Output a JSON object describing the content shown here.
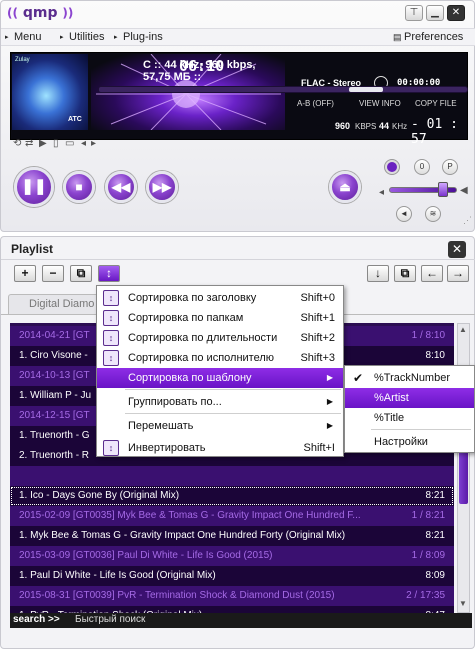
{
  "player": {
    "app_name": "qmp",
    "menu": {
      "menu_label": "Menu",
      "utilities_label": "Utilities",
      "plugins_label": "Plug-ins",
      "preferences_label": "Preferences"
    },
    "display": {
      "cover_artist": "Zulay",
      "time_big": "06:10",
      "track_info": "C :: 44 kHz, 960 kbps, 57,75 МБ ::",
      "format": "FLAC - Stereo",
      "timer": "00:00:00",
      "ab_label": "A-B (OFF)",
      "view_info": "VIEW INFO",
      "copy_file": "COPY FILE",
      "bitrate": "960",
      "bitrate_unit": "KBPS",
      "samplerate": "44",
      "samplerate_unit": "KHz",
      "remaining": "- 01 : 57",
      "seek_progress": 0.75
    },
    "controls": {
      "play_icon": "pause-icon",
      "volume": 0.85
    }
  },
  "playlist": {
    "title": "Playlist",
    "tab_label": "Digital Diamo",
    "rows": [
      {
        "type": "group",
        "left": "2014-04-21 [GT",
        "right": "1 / 8:10"
      },
      {
        "type": "track",
        "left": "1. Ciro Visone - ",
        "right": "8:10"
      },
      {
        "type": "group",
        "left": "2014-10-13 [GT",
        "right": ""
      },
      {
        "type": "track",
        "left": "1. William P - Ju",
        "right": ""
      },
      {
        "type": "group",
        "left": "2014-12-15 [GT",
        "right": ""
      },
      {
        "type": "track",
        "left": "1. Truenorth - G",
        "right": ""
      },
      {
        "type": "track",
        "left": "2. Truenorth - R",
        "right": ""
      },
      {
        "type": "group",
        "left": "",
        "right": ""
      },
      {
        "type": "track",
        "left": "1. Ico - Days Gone By (Original Mix)",
        "right": "8:21",
        "selected": true
      },
      {
        "type": "group",
        "left": "2015-02-09 [GT0035] Myk Bee & Tomas G - Gravity Impact One Hundred F...",
        "right": "1 / 8:21"
      },
      {
        "type": "track",
        "left": "1. Myk Bee & Tomas G - Gravity Impact One Hundred Forty (Original Mix)",
        "right": "8:21"
      },
      {
        "type": "group",
        "left": "2015-03-09 [GT0036] Paul Di White - Life Is Good (2015)",
        "right": "1 / 8:09"
      },
      {
        "type": "track",
        "left": "1. Paul Di White - Life Is Good (Original Mix)",
        "right": "8:09"
      },
      {
        "type": "group",
        "left": "2015-08-31 [GT0039] PvR - Termination Shock & Diamond Dust (2015)",
        "right": "2 / 17:35"
      },
      {
        "type": "track",
        "left": "1. PvR - Termination Shock (Original Mix)",
        "right": "8:47"
      }
    ],
    "search_label": "search >>",
    "search_placeholder": "Быстрый поиск"
  },
  "context_menu": {
    "items": [
      {
        "label": "Сортировка по заголовку",
        "shortcut": "Shift+0",
        "icon": "sort-title-icon"
      },
      {
        "label": "Сортировка по папкам",
        "shortcut": "Shift+1",
        "icon": "sort-folder-icon"
      },
      {
        "label": "Сортировка по длительности",
        "shortcut": "Shift+2",
        "icon": "sort-duration-icon"
      },
      {
        "label": "Сортировка по исполнителю",
        "shortcut": "Shift+3",
        "icon": "sort-artist-icon"
      },
      {
        "label": "Сортировка по шаблону",
        "shortcut": "",
        "icon": ""
      },
      {
        "label": "Группировать по...",
        "shortcut": "",
        "icon": ""
      },
      {
        "label": "Перемешать",
        "shortcut": "",
        "icon": ""
      },
      {
        "label": "Инвертировать",
        "shortcut": "Shift+I",
        "icon": "invert-icon"
      }
    ],
    "submenu": [
      {
        "label": "%TrackNumber"
      },
      {
        "label": "%Artist"
      },
      {
        "label": "%Title"
      },
      {
        "label": "Настройки"
      }
    ]
  }
}
